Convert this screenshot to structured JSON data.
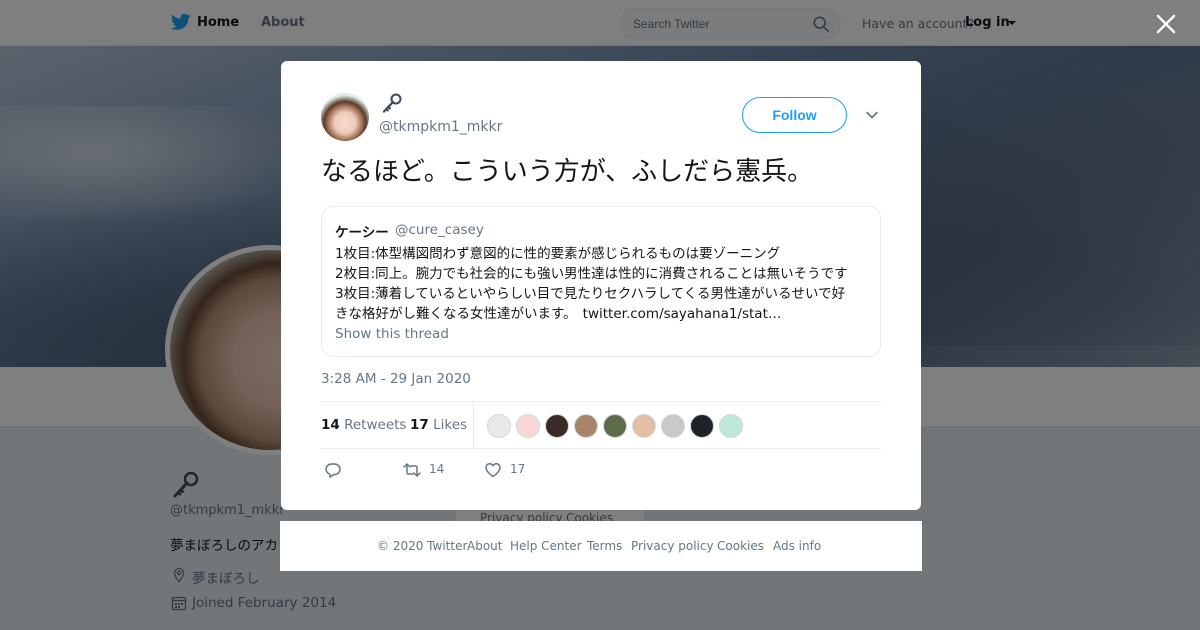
{
  "topbar": {
    "home_label": "Home",
    "about_label": "About",
    "search_placeholder": "Search Twitter",
    "have_account": "Have an account?",
    "login_label": "Log in"
  },
  "background_profile": {
    "handle": "@tkmpkm1_mkkr",
    "bio": "夢まぼろしのアカ",
    "location": "夢まぼろし",
    "joined": "Joined February 2014",
    "card_links": [
      "Privacy policy",
      "Cookies"
    ]
  },
  "tweet": {
    "author_handle": "@tkmpkm1_mkkr",
    "follow_label": "Follow",
    "text": "なるほど。こういう方が、ふしだら憲兵。",
    "quoted": {
      "name": "ケーシー",
      "handle": "@cure_casey",
      "lines": [
        "1枚目:体型構図問わず意図的に性的要素が感じられるものは要ゾーニング",
        "2枚目:同上。腕力でも社会的にも強い男性達は性的に消費されることは無いそうです",
        "3枚目:薄着しているといやらしい目で見たりセクハラしてくる男性達がいるせいで好",
        "きな格好がし難くなる女性達がいます。"
      ],
      "link": "twitter.com/sayahana1/stat…",
      "show_thread": "Show this thread"
    },
    "timestamp": "3:28 AM - 29 Jan 2020",
    "retweets_count": "14",
    "retweets_label": "Retweets",
    "likes_count": "17",
    "likes_label": "Likes",
    "action_retweets": "14",
    "action_likes": "17",
    "likers": [
      {
        "color": "#e9e9e9"
      },
      {
        "color": "#f6d6d6"
      },
      {
        "color": "#3a2a28"
      },
      {
        "color": "#a8846a"
      },
      {
        "color": "#5d6b4a"
      },
      {
        "color": "#e2bfa4"
      },
      {
        "color": "#c9c9c9"
      },
      {
        "color": "#1e2328"
      },
      {
        "color": "#bfe7dc"
      }
    ]
  },
  "footer": {
    "copyright": "© 2020 Twitter",
    "links": [
      "About",
      "Help Center",
      "Terms",
      "Privacy policy",
      "Cookies",
      "Ads info"
    ]
  },
  "colors": {
    "accent": "#1da1f2",
    "muted": "#657786",
    "text": "#14171a"
  }
}
